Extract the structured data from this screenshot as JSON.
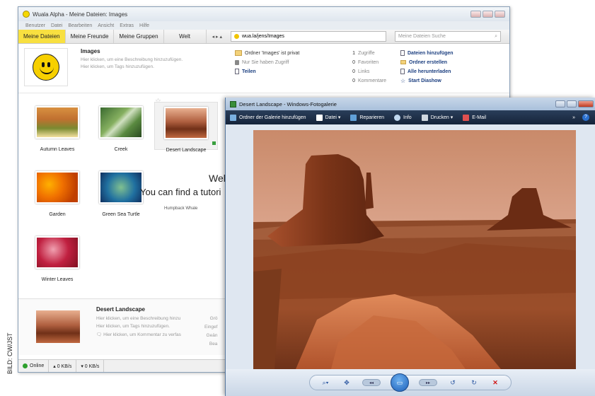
{
  "credit": "BILD: CW/JST",
  "wuala": {
    "title": "Wuala Alpha - Meine Dateien: Images",
    "menu": [
      "Benutzer",
      "Datei",
      "Bearbeiten",
      "Ansicht",
      "Extras",
      "Hilfe"
    ],
    "tabs": [
      "Meine Dateien",
      "Meine Freunde",
      "Meine Gruppen",
      "Welt"
    ],
    "nav_arrows": "◂ ▸ ▴",
    "address": "wua.la/jens/Images",
    "search_placeholder": "Meine Dateien Suche",
    "folder": {
      "title": "Images",
      "desc1": "Hier klicken, um eine Beschreibung hinzuzufügen.",
      "desc2": "Hier klicken, um Tags hinzuzufügen.",
      "privacy": "Ordner 'Images' ist privat",
      "access": "Nur Sie haben Zugriff",
      "share": "Teilen",
      "stats": [
        {
          "num": "1",
          "label": "Zugriffe"
        },
        {
          "num": "0",
          "label": "Favoriten"
        },
        {
          "num": "0",
          "label": "Links"
        },
        {
          "num": "0",
          "label": "Kommentare"
        }
      ],
      "actions": [
        "Dateien hinzufügen",
        "Ordner erstellen",
        "Alle herunterladen",
        "Start Diashow"
      ]
    },
    "thumbnails": [
      "Autumn Leaves",
      "Creek",
      "Desert Landscape",
      "Garden",
      "Green Sea Turtle",
      "Humpback Whale",
      "Winter Leaves"
    ],
    "overlay_welcome": "Welco",
    "overlay_tutorial": "You can find a tutori",
    "detail": {
      "title": "Desert Landscape",
      "line1": "Hier klicken, um eine Beschreibung hinzu",
      "line2": "Hier klicken, um Tags hinzuzufügen.",
      "line3": "Hier klicken, um Kommentar zu verfas",
      "right1": "Grö",
      "right2": "Eingef",
      "right3": "Geän",
      "right4": "Bea"
    },
    "status": {
      "online": "Online",
      "up": "▴ 0 KB/s",
      "down": "▾ 0 KB/s"
    }
  },
  "gallery": {
    "title": "Desert Landscape - Windows-Fotogalerie",
    "toolbar": [
      "Ordner der Galerie hinzufügen",
      "Datei ▾",
      "Reparieren",
      "Info",
      "Drucken ▾",
      "E-Mail"
    ],
    "more": "»",
    "help": "?"
  }
}
